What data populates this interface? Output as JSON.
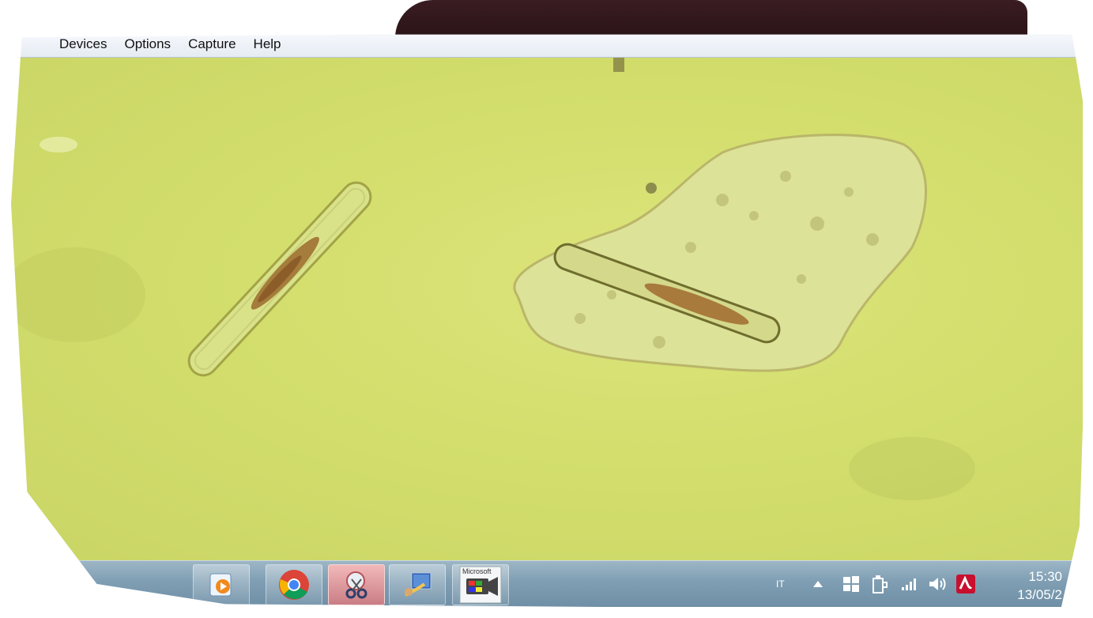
{
  "menu": {
    "items": [
      "Devices",
      "Options",
      "Capture",
      "Help"
    ]
  },
  "taskbar": {
    "apps": [
      {
        "icon": "media-player-icon"
      },
      {
        "icon": "chrome-icon"
      },
      {
        "icon": "snipping-tool-icon",
        "active": true
      },
      {
        "icon": "remote-desktop-icon"
      },
      {
        "icon": "microsoft-camera-icon",
        "label": "Microsoft"
      }
    ],
    "tray": {
      "language": "IT",
      "time": "15:30",
      "date": "13/05/2"
    }
  },
  "colors": {
    "microscope_bg": "#d3de6c",
    "taskbar": "#7f9eb3",
    "menubar": "#eef2f8",
    "antivirus": "#c8102e"
  }
}
